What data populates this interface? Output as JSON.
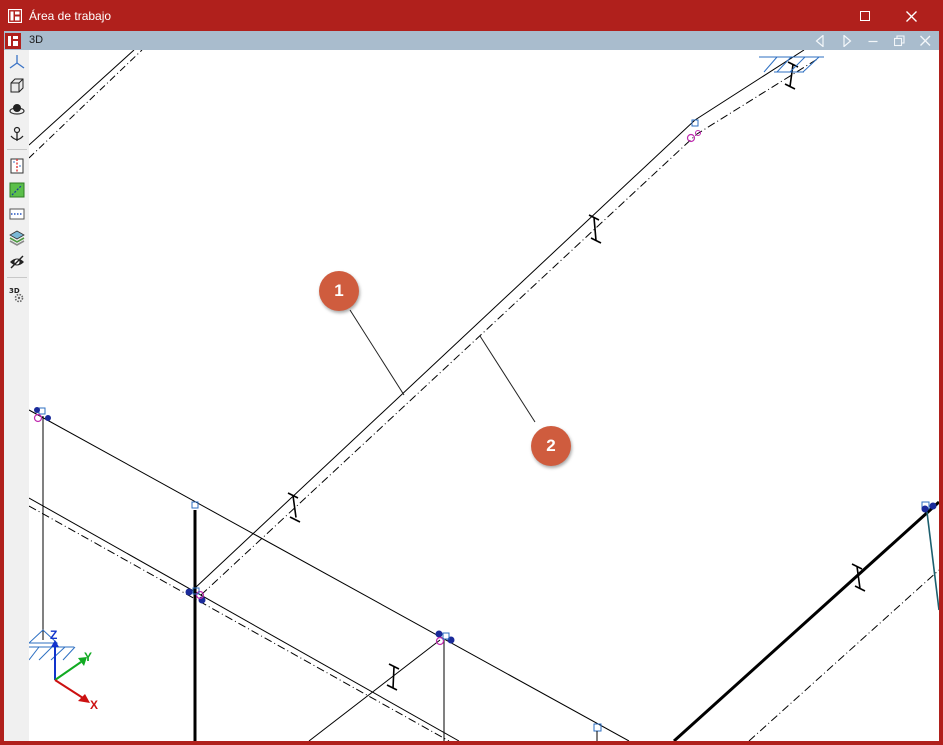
{
  "window": {
    "title": "Área de trabajo",
    "accent_color": "#b0201c",
    "maximize_icon": "maximize-icon",
    "close_icon": "close-icon"
  },
  "view_bar": {
    "view_name": "3D",
    "background_color": "#a9bccd",
    "buttons": [
      "previous-view-icon",
      "next-view-icon",
      "minimize-icon",
      "restore-icon",
      "close-icon"
    ]
  },
  "toolbar": {
    "tools": [
      "axes-icon",
      "cube-view-icon",
      "orbit-icon",
      "pan-anchor-icon",
      "section-icon",
      "diagonal-element-icon",
      "dotted-frame-icon",
      "layers-icon",
      "visibility-eye-icon",
      "3d-settings-icon"
    ]
  },
  "callouts": {
    "first": "1",
    "second": "2",
    "color": "#cf5c3e"
  },
  "axes": {
    "x_label": "X",
    "y_label": "Y",
    "z_label": "Z",
    "x_color": "#cc1111",
    "y_color": "#11aa22",
    "z_color": "#1133cc"
  }
}
